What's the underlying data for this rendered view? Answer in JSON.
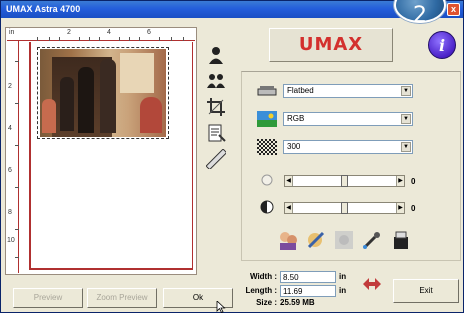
{
  "window": {
    "title": "UMAX Astra 4700",
    "close_label": "x"
  },
  "step_badge": "2",
  "ruler": {
    "top_unit": "in",
    "top_numbers": [
      "2",
      "4",
      "6"
    ],
    "left_numbers": [
      "2",
      "4",
      "6",
      "8",
      "10"
    ]
  },
  "tools": [
    {
      "icon": "person-silhouette-icon"
    },
    {
      "icon": "multiple-persons-icon"
    },
    {
      "icon": "crop-icon"
    },
    {
      "icon": "document-select-icon"
    },
    {
      "icon": "ruler-icon"
    }
  ],
  "logo": {
    "text": "UMAX"
  },
  "info_label": "i",
  "settings": {
    "source": {
      "value": "Flatbed",
      "icon": "scanner-icon"
    },
    "mode": {
      "value": "RGB",
      "icon": "color-landscape-icon"
    },
    "resolution": {
      "value": "300",
      "icon": "dpi-pattern-icon"
    }
  },
  "sliders": {
    "brightness": {
      "icon": "sun-icon",
      "value": "0",
      "level": 0.5
    },
    "contrast": {
      "icon": "contrast-icon",
      "value": "0",
      "level": 0.5
    }
  },
  "filter_icons": [
    "portrait-filter-icon",
    "sharpen-filter-icon",
    "blur-filter-icon",
    "eyedropper-icon",
    "descreen-filter-icon"
  ],
  "dimensions": {
    "width_label": "Width :",
    "width_value": "8.50",
    "width_unit": "in",
    "length_label": "Length :",
    "length_value": "11.69",
    "length_unit": "in",
    "size_label": "Size :",
    "size_value": "25.59",
    "size_unit": "MB"
  },
  "buttons": {
    "preview": "Preview",
    "zoom_preview": "Zoom Preview",
    "ok": "Ok",
    "exit": "Exit"
  },
  "colors": {
    "title_bar": "#245edb",
    "logo_red": "#d3302d",
    "info_purple": "#4b22c8",
    "ruler_red": "#b03030"
  }
}
